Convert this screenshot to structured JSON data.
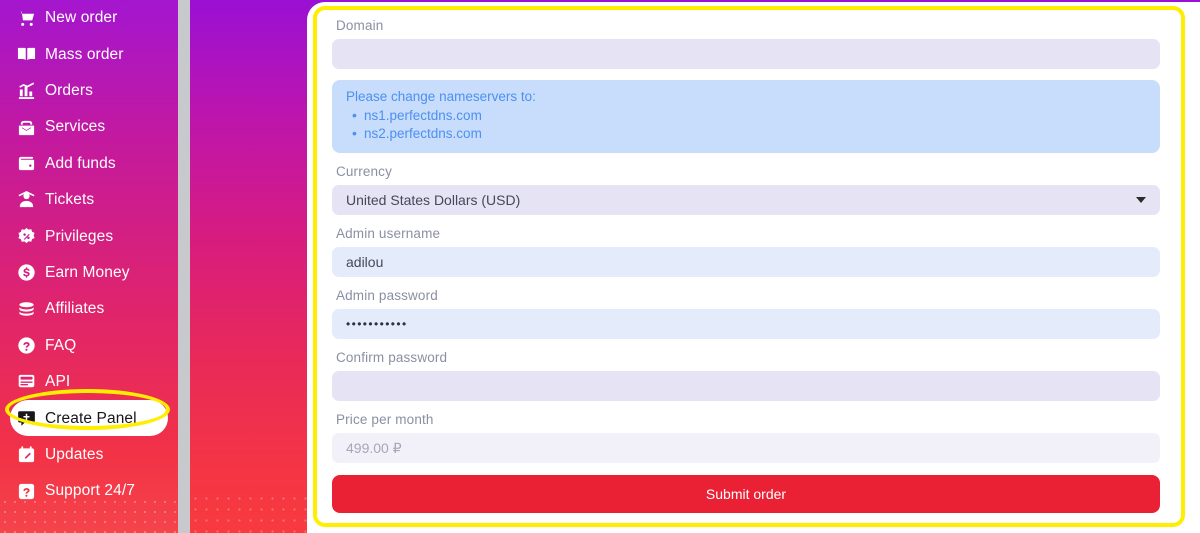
{
  "sidebar": {
    "items": [
      {
        "label": "New order",
        "icon": "cart-icon",
        "active": false
      },
      {
        "label": "Mass order",
        "icon": "book-icon",
        "active": false
      },
      {
        "label": "Orders",
        "icon": "bar-chart-icon",
        "active": false
      },
      {
        "label": "Services",
        "icon": "briefcase-icon",
        "active": false
      },
      {
        "label": "Add funds",
        "icon": "wallet-icon",
        "active": false
      },
      {
        "label": "Tickets",
        "icon": "headset-icon",
        "active": false
      },
      {
        "label": "Privileges",
        "icon": "percent-badge-icon",
        "active": false
      },
      {
        "label": "Earn Money",
        "icon": "dollar-circle-icon",
        "active": false
      },
      {
        "label": "Affiliates",
        "icon": "coins-icon",
        "active": false
      },
      {
        "label": "FAQ",
        "icon": "question-circle-icon",
        "active": false
      },
      {
        "label": "API",
        "icon": "monitor-icon",
        "active": false
      },
      {
        "label": "Create Panel",
        "icon": "plus-square-icon",
        "active": true
      },
      {
        "label": "Updates",
        "icon": "calendar-icon",
        "active": false
      },
      {
        "label": "Support 24/7",
        "icon": "question-square-icon",
        "active": false
      }
    ]
  },
  "form": {
    "domain": {
      "label": "Domain",
      "value": "",
      "placeholder": ""
    },
    "notice": {
      "title": "Please change nameservers to:",
      "items": [
        "ns1.perfectdns.com",
        "ns2.perfectdns.com"
      ]
    },
    "currency": {
      "label": "Currency",
      "value": "United States Dollars (USD)",
      "caret": "chevron-down-icon"
    },
    "admin_username": {
      "label": "Admin username",
      "value": "adilou",
      "placeholder": ""
    },
    "admin_password": {
      "label": "Admin password",
      "value": "•••••••••••",
      "placeholder": ""
    },
    "confirm_password": {
      "label": "Confirm password",
      "value": "",
      "placeholder": ""
    },
    "price_per_month": {
      "label": "Price per month",
      "value": "499.00 ₽"
    },
    "submit_label": "Submit order"
  },
  "colors": {
    "accent_red": "#ea2135",
    "annotation_yellow": "#ffee00",
    "notice_blue_bg": "#c7ddfb",
    "notice_blue_text": "#4d90f0",
    "input_lavender": "#e6e3f4",
    "input_blue": "#e4ebfb"
  }
}
